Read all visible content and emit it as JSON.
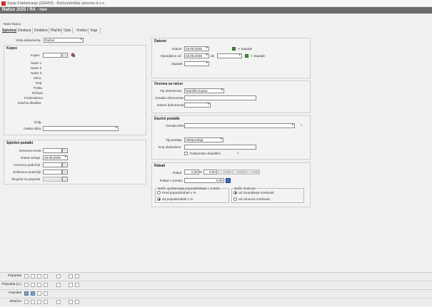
{
  "window": {
    "title": "Saop Fakturiranje [DEMO] - Računalniška oprema d.o.o",
    "document_title": "Račun  2025 / RA - nov"
  },
  "tabs": [
    "Splošno",
    "Dostava",
    "Dodatno",
    "Plačilo",
    "Opis",
    "Vrstice",
    "Vrge"
  ],
  "top": {
    "nav_label": "Nasv kupca",
    "doc_type_label": "Vrsta dokumenta",
    "doc_type_value": "Račun"
  },
  "kupec": {
    "title": "Kupec",
    "kupec_label": "Kupec",
    "fields": [
      "Naziv 1",
      "Naziv 2",
      "Naziv 3",
      "Ulica",
      "Kraj",
      "Pošta",
      "Država",
      "Poslovalnica",
      "Davčna številka"
    ],
    "dolg_label": "Dolg",
    "oseba_label": "Oseba stika"
  },
  "splosni": {
    "title": "Splošni podatki",
    "rows": [
      {
        "label": "Denarna enota",
        "value": ""
      },
      {
        "label": "Datum tečaja",
        "value": "18.08.2025"
      },
      {
        "label": "Cenovno področje",
        "value": ""
      },
      {
        "label": "Jezikovno področje",
        "value": ""
      },
      {
        "label": "Skupina za popuste",
        "value": ""
      }
    ]
  },
  "datumi": {
    "title": "Datumi",
    "datum_label": "Datum",
    "datum_value": "18.08.2025",
    "zapade_link": "-> Zapade",
    "opravljeno_label": "Opravljeno od",
    "opravljeno_value": "18.08.2025",
    "do_label": "do",
    "zapade_label": "Zapade"
  },
  "osnova": {
    "title": "Osnova za račun",
    "tip_label": "Tip dokumenta",
    "tip_value": "Naročilo kupca",
    "oznaka_label": "Oznaka dokumenta",
    "datum_label": "Datum dokumenta"
  },
  "davcni": {
    "title": "Davčni podatki",
    "oznaka_ddv_label": "Oznaka DDV",
    "tip_prodaje_label": "Tip prodaje",
    "tip_prodaje_value": "Veleprodaja",
    "kraj_label": "Kraj obdavčitve",
    "trosarinsko_label": "Trošarinsko skladišče"
  },
  "rabati": {
    "title": "Rabati",
    "rabat_label": "Rabat",
    "rabat_values": [
      "0,00",
      "%",
      "0,00",
      "0,00",
      "0,00",
      "0,00"
    ],
    "rabat_znesek_label": "Rabat v znesku",
    "rabat_znesek_value": "0,00",
    "group1_title": "Način upoštevanja popusta/rabata v znesku",
    "group1_options": [
      "Pred popusti/rabati v %",
      "Za popusti/rabati v %"
    ],
    "group2_title": "Način izračuna",
    "group2_options": [
      "od zmanjšanje vrednosti",
      "od osnovne vrednosti"
    ]
  },
  "bottom": {
    "rows": [
      "Priponka",
      "Priponka (o.)",
      "Fascikel",
      "eRačun"
    ]
  },
  "colors": {
    "docbar": "#6a6a6a",
    "accent_green": "#4a8a3a"
  }
}
